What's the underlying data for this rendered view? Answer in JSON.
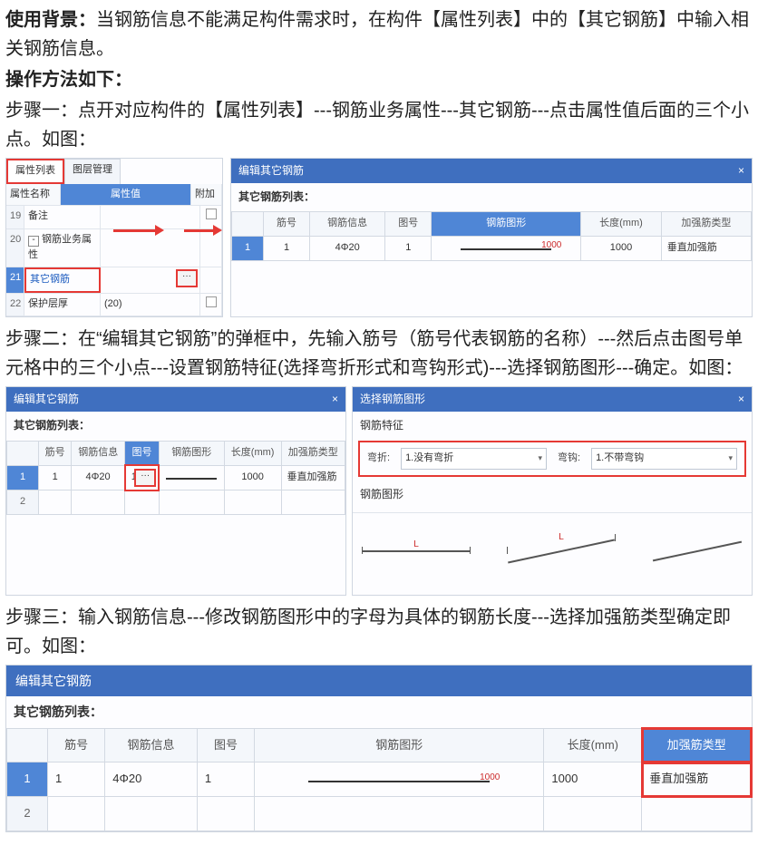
{
  "doc": {
    "p1a": "使用背景：",
    "p1b": "当钢筋信息不能满足构件需求时，在构件【属性列表】中的【其它钢筋】中输入相关钢筋信息。",
    "p2": "操作方法如下：",
    "p3": "步骤一：点开对应构件的【属性列表】---钢筋业务属性---其它钢筋---点击属性值后面的三个小点。如图：",
    "p4": "步骤二：在“编辑其它钢筋”的弹框中，先输入筋号（筋号代表钢筋的名称）---然后点击图号单元格中的三个小点---设置钢筋特征(选择弯折形式和弯钩形式)---选择钢筋图形---确定。如图：",
    "p5": "步骤三：输入钢筋信息---修改钢筋图形中的字母为具体的钢筋长度---选择加强筋类型确定即可。如图："
  },
  "fig1": {
    "tabs": {
      "attr": "属性列表",
      "layer": "图层管理"
    },
    "head": {
      "name": "属性名称",
      "value": "属性值",
      "attach": "附加"
    },
    "rows": {
      "r19": {
        "n": "19",
        "lab": "备注"
      },
      "r20": {
        "n": "20",
        "lab": "钢筋业务属性"
      },
      "r21": {
        "n": "21",
        "lab": "其它钢筋"
      },
      "r22": {
        "n": "22",
        "lab": "保护层厚",
        "val": "(20)"
      }
    },
    "ellipsis": "···",
    "dialog_title": "编辑其它钢筋",
    "list_label": "其它钢筋列表：",
    "cols": {
      "jh": "筋号",
      "info": "钢筋信息",
      "th": "图号",
      "shape": "钢筋图形",
      "len": "长度(mm)",
      "type": "加强筋类型"
    },
    "row1": {
      "n": "1",
      "jh": "1",
      "info": "4Φ20",
      "th": "1",
      "shape_label": "1000",
      "len": "1000",
      "type": "垂直加强筋"
    }
  },
  "fig2": {
    "dialog_title": "编辑其它钢筋",
    "list_label": "其它钢筋列表：",
    "cols": {
      "jh": "筋号",
      "info": "钢筋信息",
      "th": "图号",
      "shape": "钢筋图形",
      "len": "长度(mm)",
      "type": "加强筋类型"
    },
    "row1": {
      "n": "1",
      "jh": "1",
      "info": "4Φ20",
      "th": "1",
      "len": "1000",
      "type": "垂直加强筋"
    },
    "row2n": "2",
    "ellipsis": "···",
    "right_title": "选择钢筋图形",
    "section_feature": "钢筋特征",
    "bend_label": "弯折:",
    "bend_value": "1.没有弯折",
    "hook_label": "弯钩:",
    "hook_value": "1.不带弯钩",
    "section_shape": "钢筋图形",
    "shape_L": "L"
  },
  "fig3": {
    "dialog_title": "编辑其它钢筋",
    "list_label": "其它钢筋列表：",
    "cols": {
      "jh": "筋号",
      "info": "钢筋信息",
      "th": "图号",
      "shape": "钢筋图形",
      "len": "长度(mm)",
      "type": "加强筋类型"
    },
    "row1": {
      "n": "1",
      "jh": "1",
      "info": "4Φ20",
      "th": "1",
      "shape_label": "1000",
      "len": "1000",
      "type": "垂直加强筋"
    },
    "row2n": "2"
  }
}
